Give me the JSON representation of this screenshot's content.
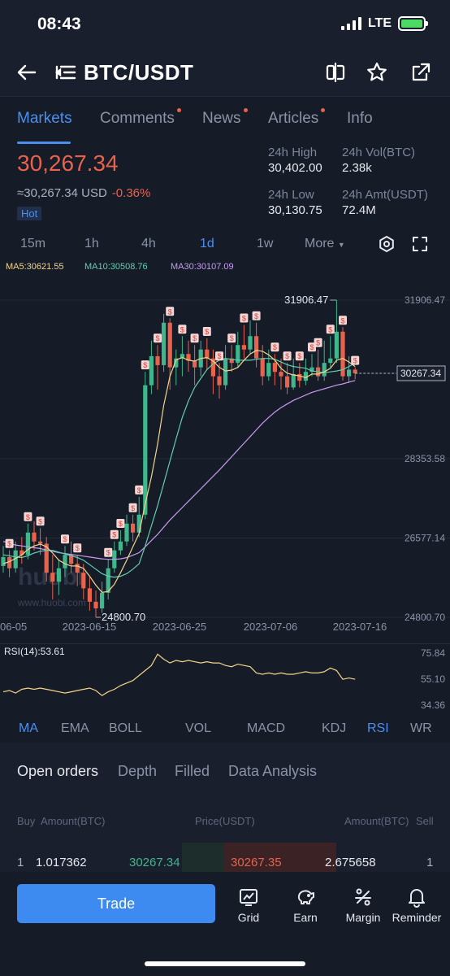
{
  "status": {
    "time": "08:43",
    "network": "LTE"
  },
  "header": {
    "pair": "BTC/USDT"
  },
  "tabs": [
    {
      "label": "Markets",
      "active": true,
      "dot": false
    },
    {
      "label": "Comments",
      "active": false,
      "dot": true
    },
    {
      "label": "News",
      "active": false,
      "dot": true
    },
    {
      "label": "Articles",
      "active": false,
      "dot": true
    },
    {
      "label": "Info",
      "active": false,
      "dot": false
    }
  ],
  "ticker": {
    "last": "30,267.34",
    "usd": "≈30,267.34 USD",
    "change": "-0.36%",
    "badge": "Hot",
    "high_label": "24h High",
    "high": "30,402.00",
    "low_label": "24h Low",
    "low": "30,130.75",
    "vol_label": "24h Vol(BTC)",
    "vol": "2.38k",
    "amt_label": "24h Amt(USDT)",
    "amt": "72.4M"
  },
  "intervals": [
    {
      "label": "15m",
      "active": false
    },
    {
      "label": "1h",
      "active": false
    },
    {
      "label": "4h",
      "active": false
    },
    {
      "label": "1d",
      "active": true
    },
    {
      "label": "1w",
      "active": false
    },
    {
      "label": "More",
      "active": false
    }
  ],
  "ma_legend": {
    "ma5": "MA5:30621.55",
    "ma10": "MA10:30508.76",
    "ma30": "MA30:30107.09"
  },
  "colors": {
    "up": "#3fb68b",
    "down": "#e8624c",
    "ma5": "#f2d58a",
    "ma10": "#5fd0b0",
    "ma30": "#c89bf0",
    "accent": "#4a8ff0"
  },
  "chart_data": {
    "type": "candlestick",
    "y_axis_labels": [
      "31906.47",
      "28353.58",
      "26577.14",
      "24800.70"
    ],
    "x_axis_labels": [
      "06-05",
      "2023-06-15",
      "2023-06-25",
      "2023-07-06",
      "2023-07-16"
    ],
    "current_price_label": "30267.34",
    "high_annotation": "31906.47",
    "low_annotation": "24800.70",
    "watermark": "huobi",
    "watermark_url": "www.huobi.com",
    "ylim": [
      24800.7,
      31906.47
    ],
    "candles": [
      {
        "o": 25950,
        "c": 26150,
        "h": 26400,
        "l": 25800
      },
      {
        "o": 26150,
        "c": 25900,
        "h": 26300,
        "l": 25700
      },
      {
        "o": 25900,
        "c": 26300,
        "h": 26500,
        "l": 25800
      },
      {
        "o": 26300,
        "c": 26200,
        "h": 26600,
        "l": 26000
      },
      {
        "o": 26200,
        "c": 26700,
        "h": 26900,
        "l": 26100
      },
      {
        "o": 26700,
        "c": 26500,
        "h": 26950,
        "l": 26300
      },
      {
        "o": 26500,
        "c": 26450,
        "h": 26800,
        "l": 26200
      },
      {
        "o": 26450,
        "c": 25800,
        "h": 26600,
        "l": 25600
      },
      {
        "o": 25800,
        "c": 25600,
        "h": 26200,
        "l": 25200
      },
      {
        "o": 25600,
        "c": 25900,
        "h": 26100,
        "l": 25300
      },
      {
        "o": 25900,
        "c": 26200,
        "h": 26400,
        "l": 25700
      },
      {
        "o": 26200,
        "c": 26000,
        "h": 26500,
        "l": 25800
      },
      {
        "o": 26000,
        "c": 25800,
        "h": 26200,
        "l": 25500
      },
      {
        "o": 25800,
        "c": 25450,
        "h": 26000,
        "l": 25200
      },
      {
        "o": 25450,
        "c": 25150,
        "h": 25700,
        "l": 24950
      },
      {
        "o": 25150,
        "c": 25000,
        "h": 25400,
        "l": 24800.7
      },
      {
        "o": 25000,
        "c": 25350,
        "h": 25600,
        "l": 24900
      },
      {
        "o": 25350,
        "c": 25900,
        "h": 26100,
        "l": 25200
      },
      {
        "o": 25900,
        "c": 26300,
        "h": 26500,
        "l": 25800
      },
      {
        "o": 26300,
        "c": 26500,
        "h": 26750,
        "l": 26200
      },
      {
        "o": 26500,
        "c": 26900,
        "h": 27100,
        "l": 26400
      },
      {
        "o": 26900,
        "c": 26700,
        "h": 27100,
        "l": 26500
      },
      {
        "o": 26700,
        "c": 27100,
        "h": 27500,
        "l": 26600
      },
      {
        "o": 27100,
        "c": 30000,
        "h": 30300,
        "l": 27000
      },
      {
        "o": 30000,
        "c": 30650,
        "h": 31000,
        "l": 29800
      },
      {
        "o": 30650,
        "c": 30450,
        "h": 30900,
        "l": 29900
      },
      {
        "o": 30450,
        "c": 31400,
        "h": 31600,
        "l": 30300
      },
      {
        "o": 31400,
        "c": 30400,
        "h": 31500,
        "l": 29900
      },
      {
        "o": 30400,
        "c": 30600,
        "h": 30800,
        "l": 30000
      },
      {
        "o": 30600,
        "c": 30700,
        "h": 31100,
        "l": 30200
      },
      {
        "o": 30700,
        "c": 30550,
        "h": 31000,
        "l": 30300
      },
      {
        "o": 30550,
        "c": 30400,
        "h": 30900,
        "l": 30000
      },
      {
        "o": 30400,
        "c": 30800,
        "h": 31000,
        "l": 30200
      },
      {
        "o": 30800,
        "c": 30600,
        "h": 31050,
        "l": 30350
      },
      {
        "o": 30600,
        "c": 30200,
        "h": 30800,
        "l": 29800
      },
      {
        "o": 30200,
        "c": 30000,
        "h": 30500,
        "l": 29700
      },
      {
        "o": 30000,
        "c": 30600,
        "h": 30900,
        "l": 29900
      },
      {
        "o": 30600,
        "c": 30500,
        "h": 30900,
        "l": 30300
      },
      {
        "o": 30500,
        "c": 30900,
        "h": 31200,
        "l": 30400
      },
      {
        "o": 30900,
        "c": 30800,
        "h": 31350,
        "l": 30600
      },
      {
        "o": 30800,
        "c": 31100,
        "h": 31450,
        "l": 30700
      },
      {
        "o": 31100,
        "c": 30600,
        "h": 31400,
        "l": 30400
      },
      {
        "o": 30600,
        "c": 30200,
        "h": 30900,
        "l": 30000
      },
      {
        "o": 30200,
        "c": 30500,
        "h": 30800,
        "l": 30100
      },
      {
        "o": 30500,
        "c": 30300,
        "h": 30700,
        "l": 30000
      },
      {
        "o": 30300,
        "c": 30200,
        "h": 30600,
        "l": 29900
      },
      {
        "o": 30200,
        "c": 29950,
        "h": 30500,
        "l": 29800
      },
      {
        "o": 29950,
        "c": 30250,
        "h": 30600,
        "l": 29900
      },
      {
        "o": 30250,
        "c": 30100,
        "h": 30500,
        "l": 29950
      },
      {
        "o": 30100,
        "c": 30300,
        "h": 30600,
        "l": 30000
      },
      {
        "o": 30300,
        "c": 30400,
        "h": 30700,
        "l": 30200
      },
      {
        "o": 30400,
        "c": 30200,
        "h": 30800,
        "l": 30100
      },
      {
        "o": 30200,
        "c": 30500,
        "h": 31000,
        "l": 30100
      },
      {
        "o": 30500,
        "c": 30600,
        "h": 31100,
        "l": 30400
      },
      {
        "o": 30600,
        "c": 31200,
        "h": 31906.47,
        "l": 30500
      },
      {
        "o": 31200,
        "c": 30200,
        "h": 31300,
        "l": 30100
      },
      {
        "o": 30200,
        "c": 30350,
        "h": 30650,
        "l": 30050
      },
      {
        "o": 30350,
        "c": 30267.34,
        "h": 30402,
        "l": 30130.75
      }
    ],
    "ma5": [
      26000,
      26050,
      26120,
      26200,
      26320,
      26400,
      26440,
      26380,
      26240,
      26080,
      26000,
      25950,
      25950,
      25900,
      25720,
      25520,
      25360,
      25380,
      25540,
      25800,
      26080,
      26380,
      26680,
      27340,
      27950,
      28680,
      29550,
      30200,
      30570,
      30620,
      30560,
      30540,
      30600,
      30620,
      30540,
      30400,
      30320,
      30340,
      30400,
      30560,
      30700,
      30780,
      30760,
      30680,
      30560,
      30380,
      30270,
      30230,
      30210,
      30170,
      30250,
      30250,
      30300,
      30380,
      30560,
      30600,
      30520,
      30420
    ],
    "ma10": [
      26200,
      26180,
      26150,
      26140,
      26180,
      26240,
      26280,
      26300,
      26300,
      26260,
      26220,
      26180,
      26140,
      26080,
      25980,
      25880,
      25780,
      25720,
      25700,
      25720,
      25780,
      25880,
      26000,
      26400,
      26850,
      27300,
      27800,
      28300,
      28800,
      29280,
      29650,
      29950,
      30150,
      30350,
      30480,
      30560,
      30600,
      30580,
      30560,
      30560,
      30560,
      30580,
      30600,
      30600,
      30580,
      30520,
      30460,
      30420,
      30400,
      30380,
      30320,
      30300,
      30280,
      30300,
      30320,
      30350,
      30420,
      30500
    ],
    "ma30": [
      26500,
      26460,
      26420,
      26400,
      26380,
      26360,
      26340,
      26310,
      26280,
      26250,
      26230,
      26210,
      26190,
      26170,
      26150,
      26130,
      26110,
      26100,
      26100,
      26110,
      26140,
      26190,
      26250,
      26380,
      26520,
      26660,
      26820,
      26980,
      27120,
      27260,
      27400,
      27540,
      27680,
      27820,
      27960,
      28100,
      28250,
      28400,
      28550,
      28700,
      28850,
      29000,
      29150,
      29280,
      29400,
      29500,
      29580,
      29660,
      29720,
      29780,
      29840,
      29880,
      29920,
      29960,
      30000,
      30030,
      30070,
      30107.09
    ]
  },
  "rsi": {
    "label": "RSI(14):53.61",
    "axis": [
      "75.84",
      "55.10",
      "34.36"
    ],
    "ylim": [
      34.36,
      75.84
    ],
    "values": [
      45,
      46,
      44,
      47,
      48,
      47,
      48,
      47,
      46,
      45,
      44,
      45,
      46,
      47,
      48,
      46,
      42,
      45,
      47,
      50,
      52,
      54,
      58,
      62,
      66,
      75,
      71,
      68,
      70,
      69,
      70,
      69,
      68,
      69,
      68,
      68,
      66,
      65,
      67,
      66,
      65,
      60,
      59,
      60,
      59,
      60,
      59,
      59,
      60,
      61,
      60,
      60,
      61,
      64,
      62,
      55,
      56,
      55
    ]
  },
  "indicator_tabs": [
    {
      "label": "MA",
      "active": true
    },
    {
      "label": "EMA",
      "active": false
    },
    {
      "label": "BOLL",
      "active": false
    },
    {
      "label": "VOL",
      "active": false
    },
    {
      "label": "MACD",
      "active": false
    },
    {
      "label": "KDJ",
      "active": false
    },
    {
      "label": "RSI",
      "active": true
    },
    {
      "label": "WR",
      "active": false
    }
  ],
  "orders": {
    "tabs": [
      "Open orders",
      "Depth",
      "Filled",
      "Data Analysis"
    ],
    "head": {
      "buy": "Buy",
      "amt_left": "Amount(BTC)",
      "price": "Price(USDT)",
      "amt_right": "Amount(BTC)",
      "sell": "Sell"
    },
    "row": {
      "idx_left": "1",
      "bid_amt": "1.017362",
      "bid_price": "30267.34",
      "ask_price": "30267.35",
      "ask_amt": "2.675658",
      "idx_right": "1"
    }
  },
  "bottom": {
    "trade": "Trade",
    "nav": [
      "Grid",
      "Earn",
      "Margin",
      "Reminder"
    ]
  }
}
